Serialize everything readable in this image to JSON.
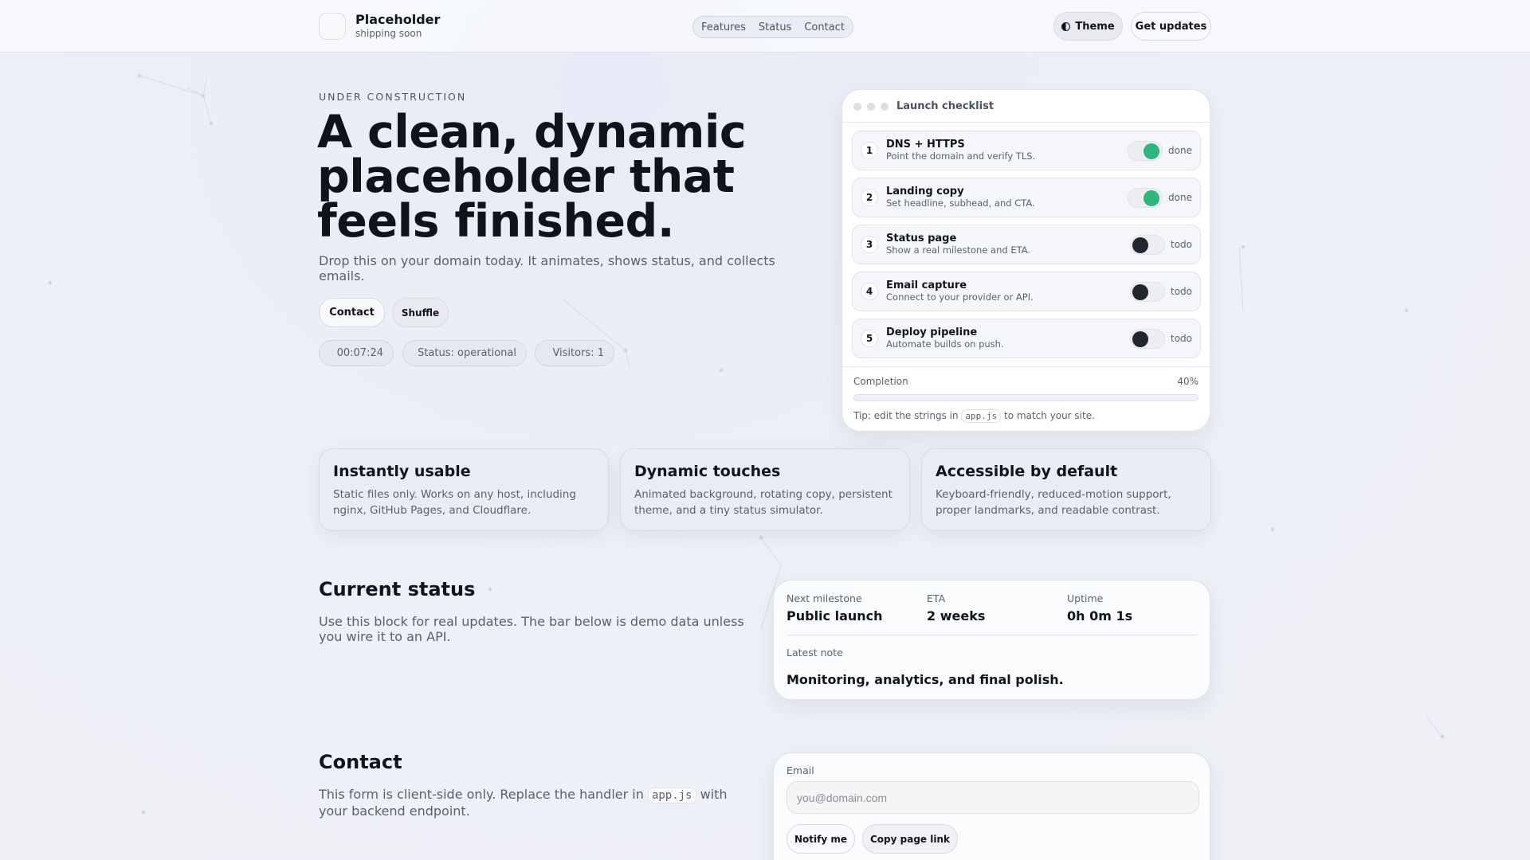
{
  "header": {
    "brand_title": "Placeholder",
    "brand_subtitle": "shipping soon",
    "nav": [
      "Features",
      "Status",
      "Contact"
    ],
    "theme_label": "Theme",
    "updates_label": "Get updates"
  },
  "hero": {
    "eyebrow": "UNDER CONSTRUCTION",
    "title": "A clean, dynamic placeholder that feels finished.",
    "subtitle": "Drop this on your domain today. It animates, shows status, and collects emails.",
    "contact_label": "Contact",
    "shuffle_label": "Shuffle",
    "timer": "00:07:24",
    "status": "Status: operational",
    "visitors": "Visitors: 1"
  },
  "checklist": {
    "title": "Launch checklist",
    "items": [
      {
        "num": "1",
        "title": "DNS + HTTPS",
        "desc": "Point the domain and verify TLS.",
        "state": "done",
        "on": true
      },
      {
        "num": "2",
        "title": "Landing copy",
        "desc": "Set headline, subhead, and CTA.",
        "state": "done",
        "on": true
      },
      {
        "num": "3",
        "title": "Status page",
        "desc": "Show a real milestone and ETA.",
        "state": "todo",
        "on": false
      },
      {
        "num": "4",
        "title": "Email capture",
        "desc": "Connect to your provider or API.",
        "state": "todo",
        "on": false
      },
      {
        "num": "5",
        "title": "Deploy pipeline",
        "desc": "Automate builds on push.",
        "state": "todo",
        "on": false
      }
    ],
    "completion_label": "Completion",
    "completion_value": "40%",
    "completion_percent": 40,
    "tip_prefix": "Tip: edit the strings in",
    "tip_code": "app.js",
    "tip_suffix": "to match your site."
  },
  "features": [
    {
      "title": "Instantly usable",
      "desc": "Static files only. Works on any host, including nginx, GitHub Pages, and Cloudflare."
    },
    {
      "title": "Dynamic touches",
      "desc": "Animated background, rotating copy, persistent theme, and a tiny status simulator."
    },
    {
      "title": "Accessible by default",
      "desc": "Keyboard-friendly, reduced-motion support, proper landmarks, and readable contrast."
    }
  ],
  "status": {
    "heading": "Current status",
    "desc": "Use this block for real updates. The bar below is demo data unless you wire it to an API.",
    "milestone_label": "Next milestone",
    "milestone_value": "Public launch",
    "eta_label": "ETA",
    "eta_value": "2 weeks",
    "uptime_label": "Uptime",
    "uptime_value": "0h 0m 1s",
    "note_label": "Latest note",
    "note_value": "Monitoring, analytics, and final polish."
  },
  "contact": {
    "heading": "Contact",
    "desc_prefix": "This form is client-side only. Replace the handler in",
    "desc_code": "app.js",
    "desc_suffix": "with your backend endpoint.",
    "email_label": "Email",
    "email_placeholder": "you@domain.com",
    "notify_label": "Notify me",
    "copy_label": "Copy page link"
  },
  "colors": {
    "done": "#2fb67c",
    "todo": "#22252c"
  }
}
